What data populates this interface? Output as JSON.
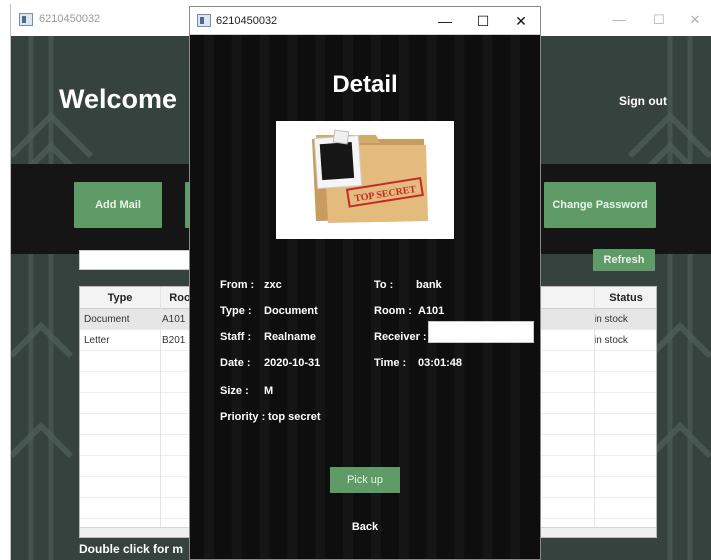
{
  "background_window": {
    "title": "6210450032",
    "welcome": "Welcome",
    "sign_out": "Sign out",
    "buttons": {
      "add_mail": "Add Mail",
      "change_password": "Change Password",
      "refresh": "Refresh"
    },
    "table": {
      "columns": [
        "Type",
        "Roo",
        "Status"
      ],
      "rows": [
        {
          "type": "Document",
          "room": "A101",
          "status": "in stock"
        },
        {
          "type": "Letter",
          "room": "B201",
          "status": "in stock"
        }
      ]
    },
    "hint": "Double click for m"
  },
  "detail_window": {
    "title": "6210450032",
    "heading": "Detail",
    "fields": {
      "from": {
        "label": "From :",
        "value": "zxc"
      },
      "to": {
        "label": "To :",
        "value": "bank"
      },
      "type": {
        "label": "Type :",
        "value": "Document"
      },
      "room": {
        "label": "Room :",
        "value": "A101"
      },
      "staff": {
        "label": "Staff :",
        "value": "Realname"
      },
      "receiver": {
        "label": "Receiver :",
        "value": ""
      },
      "date": {
        "label": "Date :",
        "value": "2020-10-31"
      },
      "time": {
        "label": "Time :",
        "value": "03:01:48"
      },
      "size": {
        "label": "Size :",
        "value": "M"
      },
      "priority": {
        "label": "Priority :",
        "value": "top secret"
      }
    },
    "stamp": "TOP SECRET",
    "pickup_label": "Pick up",
    "back_label": "Back"
  },
  "window_controls": {
    "minimize": "—",
    "maximize": "☐",
    "close": "✕"
  },
  "colors": {
    "accent_green": "#5f9b66",
    "background_dark": "#35423d",
    "modal_bg": "#0d0d0d"
  }
}
